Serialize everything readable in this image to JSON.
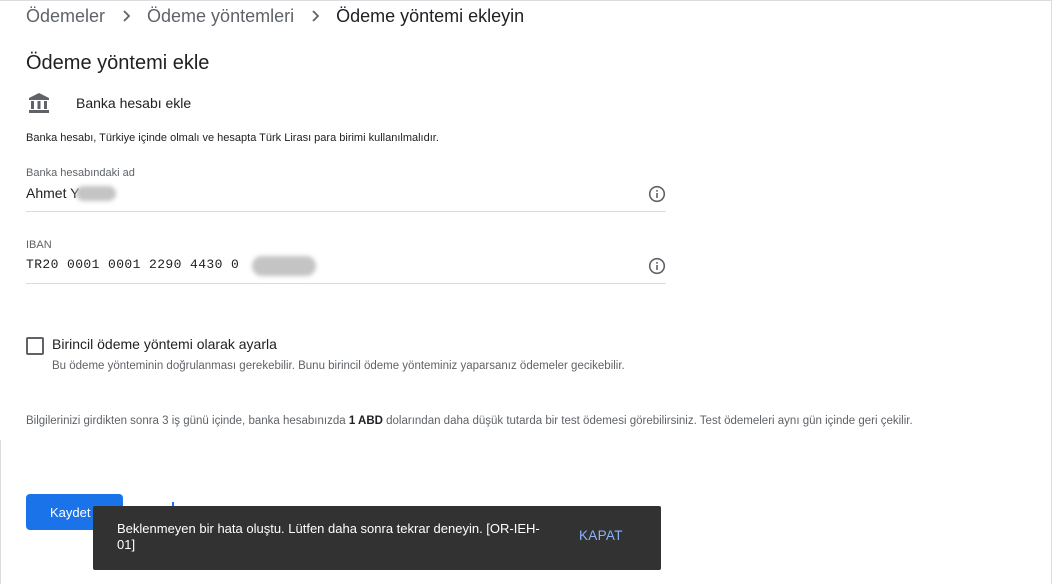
{
  "breadcrumb": {
    "items": [
      "Ödemeler",
      "Ödeme yöntemleri",
      "Ödeme yöntemi ekleyin"
    ]
  },
  "page": {
    "title": "Ödeme yöntemi ekle"
  },
  "bank": {
    "icon": "bank-icon",
    "label": "Banka hesabı ekle",
    "notice": "Banka hesabı, Türkiye içinde olmalı ve hesapta Türk Lirası para birimi kullanılmalıdır."
  },
  "fields": {
    "account_name": {
      "label": "Banka hesabındaki ad",
      "value": "Ahmet Y"
    },
    "iban": {
      "label": "IBAN",
      "value": "TR20 0001 0001 2290 4430 0"
    }
  },
  "primary": {
    "label": "Birincil ödeme yöntemi olarak ayarla",
    "sub": "Bu ödeme yönteminin doğrulanması gerekebilir. Bunu birincil ödeme yönteminiz yaparsanız ödemeler gecikebilir.",
    "checked": false
  },
  "info": {
    "before": "Bilgilerinizi girdikten sonra 3 iş günü içinde, banka hesabınızda ",
    "bold": "1 ABD",
    "after": " dolarından daha düşük tutarda bir test ödemesi görebilirsiniz. Test ödemeleri aynı gün içinde geri çekilir."
  },
  "actions": {
    "save_label": "Kaydet"
  },
  "snackbar": {
    "message": "Beklenmeyen bir hata oluştu. Lütfen daha sonra tekrar deneyin. [OR-IEH-01]",
    "action": "KAPAT"
  },
  "colors": {
    "primary": "#1a73e8",
    "snackbar_bg": "#323232",
    "snackbar_action": "#8ab4f8"
  }
}
